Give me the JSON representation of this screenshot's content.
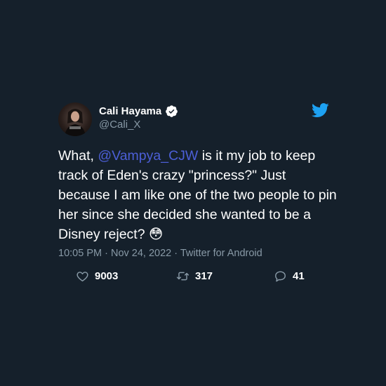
{
  "author": {
    "name": "Cali Hayama",
    "handle": "@Cali_X"
  },
  "tweet": {
    "text_before": "What, ",
    "mention": "@Vampya_CJW",
    "text_after": " is it my job to keep track of Eden's crazy \"princess?\" Just because I am like one of the two people to pin her since she decided she wanted to be a Disney reject? ",
    "emoji": "😳"
  },
  "meta": {
    "time": "10:05 PM",
    "separator": " · ",
    "date": "Nov 24, 2022",
    "source": "Twitter for Android"
  },
  "stats": {
    "likes": "9003",
    "retweets": "317",
    "replies": "41"
  },
  "colors": {
    "background": "#15202b",
    "mention": "#4c5fd7",
    "twitter_blue": "#1da1f2",
    "muted": "#8899a6"
  },
  "icons": [
    "verified-badge-icon",
    "twitter-bird-icon",
    "heart-icon",
    "retweet-icon",
    "reply-icon"
  ]
}
